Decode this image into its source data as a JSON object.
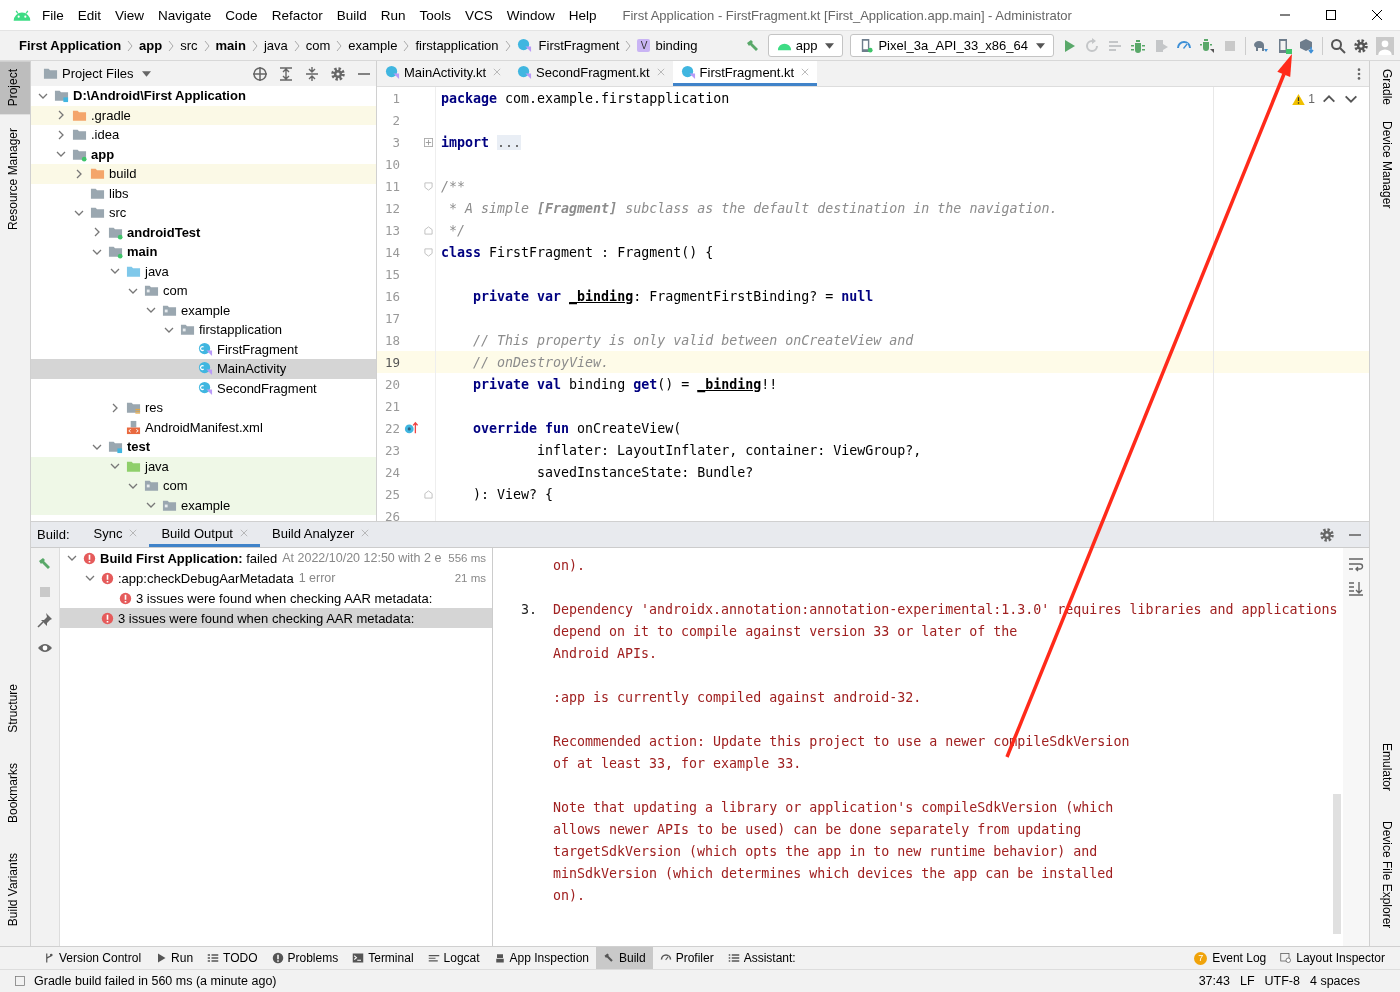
{
  "window": {
    "title": "First Application - FirstFragment.kt [First_Application.app.main] - Administrator"
  },
  "menu": [
    "File",
    "Edit",
    "View",
    "Navigate",
    "Code",
    "Refactor",
    "Build",
    "Run",
    "Tools",
    "VCS",
    "Window",
    "Help"
  ],
  "breadcrumbs": [
    {
      "label": "First Application",
      "bold": true
    },
    {
      "label": "app",
      "bold": true
    },
    {
      "label": "src",
      "bold": false
    },
    {
      "label": "main",
      "bold": true
    },
    {
      "label": "java",
      "bold": false
    },
    {
      "label": "com",
      "bold": false
    },
    {
      "label": "example",
      "bold": false
    },
    {
      "label": "firstapplication",
      "bold": false
    },
    {
      "label": "FirstFragment",
      "bold": false,
      "kind": "class"
    },
    {
      "label": "binding",
      "bold": false,
      "kind": "value",
      "badge": "V"
    }
  ],
  "run_config": "app",
  "device": "Pixel_3a_API_33_x86_64",
  "left_tools": {
    "top": [
      {
        "label": "Project",
        "selected": true
      },
      {
        "label": "Resource Manager",
        "selected": false
      }
    ],
    "bottom": [
      {
        "label": "Structure",
        "selected": false
      },
      {
        "label": "Bookmarks",
        "selected": false
      },
      {
        "label": "Build Variants",
        "selected": false
      }
    ]
  },
  "right_tools": {
    "top": [
      "Gradle",
      "Device Manager"
    ],
    "bottom": [
      "Emulator",
      "Device File Explorer"
    ]
  },
  "project": {
    "view": "Project Files",
    "tree": [
      {
        "label": "D:\\Android\\First Application",
        "kind": "project",
        "bold": true,
        "expanded": true,
        "selected": false,
        "children": [
          {
            "label": ".gradle",
            "kind": "excluded",
            "bold": false,
            "expanded": false,
            "selected": false,
            "ignored": true
          },
          {
            "label": ".idea",
            "kind": "folder",
            "bold": false,
            "expanded": false,
            "selected": false
          },
          {
            "label": "app",
            "kind": "module",
            "bold": true,
            "expanded": true,
            "selected": false,
            "children": [
              {
                "label": "build",
                "kind": "excluded",
                "bold": false,
                "expanded": false,
                "selected": false,
                "ignored": true
              },
              {
                "label": "libs",
                "kind": "folder",
                "bold": false,
                "selected": false
              },
              {
                "label": "src",
                "kind": "folder",
                "bold": false,
                "expanded": true,
                "selected": false,
                "children": [
                  {
                    "label": "androidTest",
                    "kind": "module",
                    "bold": true,
                    "expanded": false,
                    "selected": false
                  },
                  {
                    "label": "main",
                    "kind": "module",
                    "bold": true,
                    "expanded": true,
                    "selected": false,
                    "children": [
                      {
                        "label": "java",
                        "kind": "source",
                        "bold": false,
                        "expanded": true,
                        "selected": false,
                        "children": [
                          {
                            "label": "com",
                            "kind": "package",
                            "bold": false,
                            "expanded": true,
                            "selected": false,
                            "children": [
                              {
                                "label": "example",
                                "kind": "package",
                                "bold": false,
                                "expanded": true,
                                "selected": false,
                                "children": [
                                  {
                                    "label": "firstapplication",
                                    "kind": "package",
                                    "bold": false,
                                    "expanded": true,
                                    "selected": false,
                                    "children": [
                                      {
                                        "label": "FirstFragment",
                                        "kind": "class",
                                        "bold": false,
                                        "selected": false
                                      },
                                      {
                                        "label": "MainActivity",
                                        "kind": "class",
                                        "bold": false,
                                        "selected": true
                                      },
                                      {
                                        "label": "SecondFragment",
                                        "kind": "class",
                                        "bold": false,
                                        "selected": false
                                      }
                                    ]
                                  }
                                ]
                              }
                            ]
                          }
                        ]
                      },
                      {
                        "label": "res",
                        "kind": "res",
                        "bold": false,
                        "expanded": false,
                        "selected": false
                      },
                      {
                        "label": "AndroidManifest.xml",
                        "kind": "manifest",
                        "bold": false,
                        "selected": false
                      }
                    ]
                  },
                  {
                    "label": "test",
                    "kind": "project",
                    "bold": true,
                    "expanded": true,
                    "selected": false,
                    "children": [
                      {
                        "label": "java",
                        "kind": "test-source",
                        "bold": false,
                        "expanded": true,
                        "selected": false,
                        "test_scope": true,
                        "children": [
                          {
                            "label": "com",
                            "kind": "package",
                            "bold": false,
                            "expanded": true,
                            "selected": false,
                            "test_scope": true,
                            "children": [
                              {
                                "label": "example",
                                "kind": "package",
                                "bold": false,
                                "expanded": true,
                                "selected": false,
                                "test_scope": true
                              }
                            ]
                          }
                        ]
                      }
                    ]
                  }
                ]
              }
            ]
          }
        ]
      }
    ]
  },
  "editor": {
    "tabs": [
      {
        "label": "MainActivity.kt",
        "selected": false
      },
      {
        "label": "SecondFragment.kt",
        "selected": false
      },
      {
        "label": "FirstFragment.kt",
        "selected": true
      }
    ],
    "warnings": "1",
    "lines": [
      {
        "number": "1",
        "current": false,
        "segments": [
          {
            "kind": "kw",
            "text": "package "
          },
          {
            "kind": "plain",
            "text": "com.example.firstapplication"
          }
        ]
      },
      {
        "number": "2",
        "current": false
      },
      {
        "number": "3",
        "current": false,
        "collapsed": true,
        "segments": [
          {
            "kind": "kw",
            "text": "import "
          },
          {
            "kind": "fold",
            "text": "..."
          }
        ]
      },
      {
        "number": "10",
        "current": false
      },
      {
        "number": "11",
        "current": false,
        "fold_start": true,
        "segments": [
          {
            "kind": "comment",
            "text": "/**"
          }
        ]
      },
      {
        "number": "12",
        "current": false,
        "segments": [
          {
            "kind": "comment",
            "text": " * A simple "
          },
          {
            "kind": "doc-ref",
            "text": "[Fragment]"
          },
          {
            "kind": "comment",
            "text": " subclass as the default destination in the navigation."
          }
        ]
      },
      {
        "number": "13",
        "current": false,
        "fold_end": true,
        "segments": [
          {
            "kind": "comment",
            "text": " */"
          }
        ]
      },
      {
        "number": "14",
        "current": false,
        "fold_start": true,
        "segments": [
          {
            "kind": "kw",
            "text": "class "
          },
          {
            "kind": "plain",
            "text": "FirstFragment : Fragment() {"
          }
        ]
      },
      {
        "number": "15",
        "current": false
      },
      {
        "number": "16",
        "current": false,
        "segments": [
          {
            "kind": "kw",
            "text": "    private var "
          },
          {
            "kind": "ref",
            "text": "_binding"
          },
          {
            "kind": "plain",
            "text": ": FragmentFirstBinding? = "
          },
          {
            "kind": "kw",
            "text": "null"
          }
        ]
      },
      {
        "number": "17",
        "current": false
      },
      {
        "number": "18",
        "current": false,
        "segments": [
          {
            "kind": "comment",
            "text": "    // This property is only valid between onCreateView and"
          }
        ]
      },
      {
        "number": "19",
        "current": true,
        "segments": [
          {
            "kind": "comment",
            "text": "    // onDestroyView."
          }
        ]
      },
      {
        "number": "20",
        "current": false,
        "segments": [
          {
            "kind": "kw",
            "text": "    private val "
          },
          {
            "kind": "plain",
            "text": "binding "
          },
          {
            "kind": "kw",
            "text": "get"
          },
          {
            "kind": "plain",
            "text": "() = "
          },
          {
            "kind": "ref",
            "text": "_binding"
          },
          {
            "kind": "plain",
            "text": "!!"
          }
        ]
      },
      {
        "number": "21",
        "current": false
      },
      {
        "number": "22",
        "current": false,
        "override": true,
        "segments": [
          {
            "kind": "kw",
            "text": "    override fun "
          },
          {
            "kind": "plain",
            "text": "onCreateView("
          }
        ]
      },
      {
        "number": "23",
        "current": false,
        "segments": [
          {
            "kind": "plain",
            "text": "            inflater: LayoutInflater, container: ViewGroup?,"
          }
        ]
      },
      {
        "number": "24",
        "current": false,
        "segments": [
          {
            "kind": "plain",
            "text": "            savedInstanceState: Bundle?"
          }
        ]
      },
      {
        "number": "25",
        "current": false,
        "fold_end": true,
        "segments": [
          {
            "kind": "plain",
            "text": "    ): View? {"
          }
        ]
      },
      {
        "number": "26",
        "current": false
      }
    ]
  },
  "build": {
    "label": "Build:",
    "tabs": [
      {
        "label": "Sync",
        "selected": false
      },
      {
        "label": "Build Output",
        "selected": true
      },
      {
        "label": "Build Analyzer",
        "selected": false
      }
    ],
    "tree": [
      {
        "title": "**Build First Application:** failed",
        "detail": "At 2022/10/20 12:50 with 2 e",
        "time": "556 ms",
        "expanded": true,
        "selected": false,
        "children": [
          {
            "title": ":app:checkDebugAarMetadata",
            "detail": "1 error",
            "time": "21 ms",
            "expanded": true,
            "selected": false,
            "children": [
              {
                "title": "3 issues were found when checking AAR metadata:",
                "selected": false
              }
            ]
          },
          {
            "title": "3 issues were found when checking AAR metadata:",
            "selected": true
          }
        ]
      }
    ],
    "output": [
      {
        "lines": [
          "on)."
        ]
      },
      {
        "marker": "3.",
        "lines": [
          "Dependency 'androidx.annotation:annotation-experimental:1.3.0' requires libraries and applications",
          "depend on it to compile against version 33 or later of the",
          "Android APIs."
        ]
      },
      {
        "lines": [
          ":app is currently compiled against android-32."
        ]
      },
      {
        "lines": [
          "Recommended action: Update this project to use a newer compileSdkVersion",
          "of at least 33, for example 33."
        ]
      },
      {
        "lines": [
          "Note that updating a library or application's compileSdkVersion (which",
          "allows newer APIs to be used) can be done separately from updating",
          "targetSdkVersion (which opts the app in to new runtime behavior) and",
          "minSdkVersion (which determines which devices the app can be installed",
          "on)."
        ]
      }
    ]
  },
  "tool_windows": [
    {
      "label": "Version Control",
      "kind": "vcs",
      "selected": false
    },
    {
      "label": "Run",
      "kind": "run",
      "selected": false
    },
    {
      "label": "TODO",
      "kind": "todo",
      "selected": false
    },
    {
      "label": "Problems",
      "kind": "problems",
      "selected": false
    },
    {
      "label": "Terminal",
      "kind": "terminal",
      "selected": false
    },
    {
      "label": "Logcat",
      "kind": "logcat",
      "selected": false
    },
    {
      "label": "App Inspection",
      "kind": "inspection",
      "selected": false
    },
    {
      "label": "Build",
      "kind": "build",
      "selected": true
    },
    {
      "label": "Profiler",
      "kind": "profiler",
      "selected": false
    },
    {
      "label": "Assistant:",
      "kind": "assistant",
      "selected": false
    }
  ],
  "tool_windows_right": [
    {
      "label": "Event Log",
      "badge": "7"
    },
    {
      "label": "Layout Inspector"
    }
  ],
  "status_bar": {
    "message": "Gradle build failed in 560 ms (a minute ago)",
    "items": [
      "37:43",
      "LF",
      "UTF-8",
      "4 spaces"
    ]
  }
}
